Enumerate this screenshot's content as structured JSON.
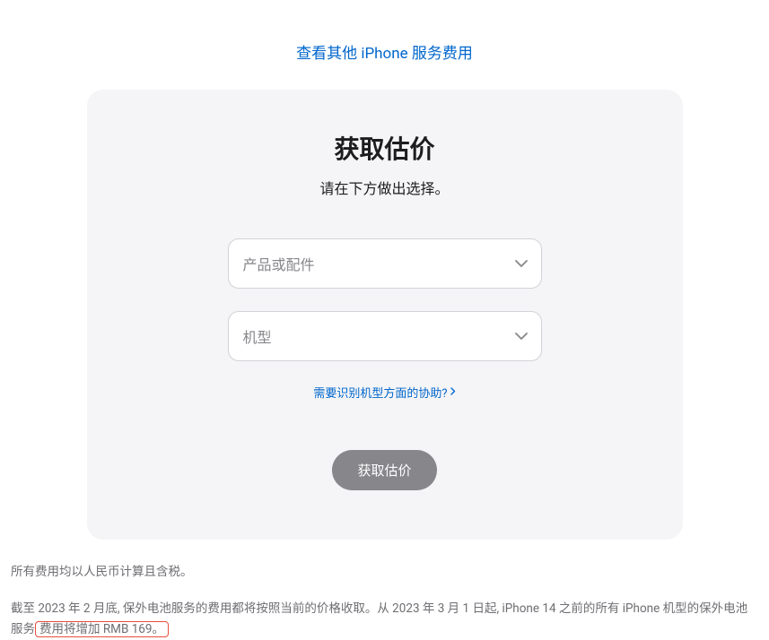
{
  "topLink": {
    "label": "查看其他 iPhone 服务费用"
  },
  "card": {
    "title": "获取估价",
    "subtitle": "请在下方做出选择。",
    "select1": {
      "placeholder": "产品或配件"
    },
    "select2": {
      "placeholder": "机型"
    },
    "helpLink": {
      "label": "需要识别机型方面的协助?"
    },
    "submitButton": {
      "label": "获取估价"
    }
  },
  "footer": {
    "line1": "所有费用均以人民币计算且含税。",
    "line2_part1": "截至 2023 年 2 月底, 保外电池服务的费用都将按照当前的价格收取。从 2023 年 3 月 1 日起, iPhone 14 之前的所有 iPhone 机型的保外电池服务",
    "line2_highlight": "费用将增加 RMB 169。"
  }
}
